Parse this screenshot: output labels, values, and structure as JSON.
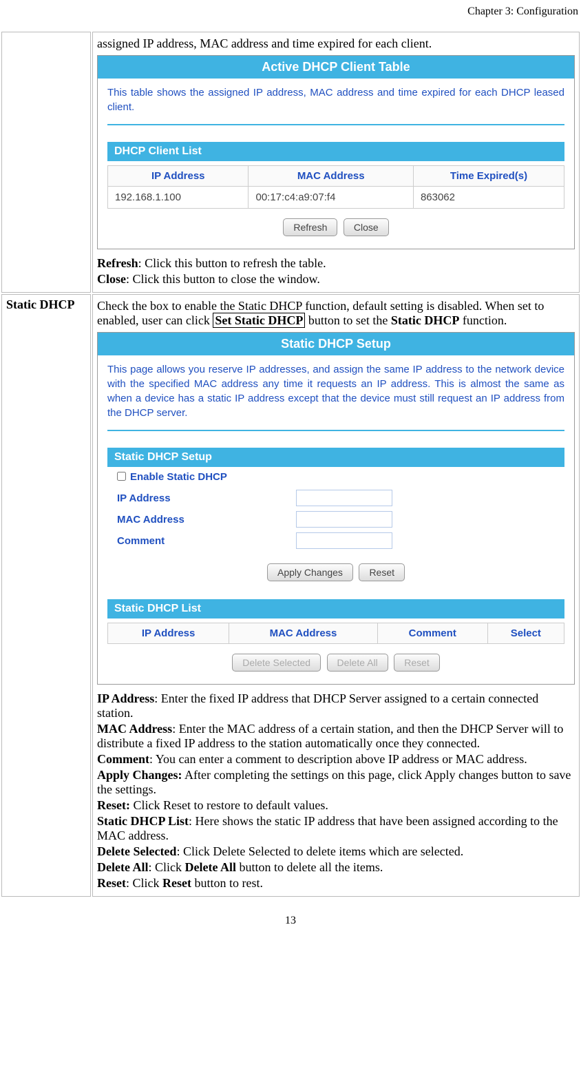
{
  "header": {
    "chapter": "Chapter 3: Configuration"
  },
  "row1": {
    "intro": "assigned IP address, MAC address and time expired for each client.",
    "panel_title": "Active DHCP Client Table",
    "panel_desc": "This table shows the assigned IP address, MAC address and time expired for each DHCP leased client.",
    "subtitle": "DHCP Client List",
    "cols": {
      "ip": "IP Address",
      "mac": "MAC Address",
      "time": "Time Expired(s)"
    },
    "data_row": {
      "ip": "192.168.1.100",
      "mac": "00:17:c4:a9:07:f4",
      "time": "863062"
    },
    "btn_refresh": "Refresh",
    "btn_close": "Close",
    "def_refresh_label": "Refresh",
    "def_refresh_text": ": Click this button to refresh the table.",
    "def_close_label": "Close",
    "def_close_text": ": Click this button to close the window."
  },
  "row2": {
    "label": "Static DHCP",
    "intro1": "Check the box to enable the Static DHCP function, default setting is disabled. When set to enabled, user can click ",
    "intro_boxed": "Set Static DHCP",
    "intro2": " button to set the ",
    "intro_bold": "Static DHCP",
    "intro3": " function.",
    "panel_title": "Static DHCP Setup",
    "panel_desc": "This page allows you reserve IP addresses, and assign the same IP address to the network device with the specified MAC address any time it requests an IP address. This is almost the same as when a device has a static IP address except that the device must still request an IP address from the DHCP server.",
    "subtitle_setup": "Static DHCP Setup",
    "enable_label": "Enable Static DHCP",
    "form": {
      "ip": "IP Address",
      "mac": "MAC Address",
      "comment": "Comment"
    },
    "btn_apply": "Apply Changes",
    "btn_reset": "Reset",
    "subtitle_list": "Static DHCP List",
    "list_cols": {
      "ip": "IP Address",
      "mac": "MAC Address",
      "comment": "Comment",
      "select": "Select"
    },
    "btn_delsel": "Delete Selected",
    "btn_delall": "Delete All",
    "btn_reset2": "Reset",
    "defs": {
      "ip_label": "IP Address",
      "ip_text": ": Enter the fixed IP address that DHCP Server assigned to a certain connected station.",
      "mac_label": "MAC Address",
      "mac_text": ": Enter the MAC address of a certain station, and then the DHCP Server will to distribute a fixed IP address to the station automatically once they connected.",
      "comment_label": "Comment",
      "comment_text": ": You can enter a comment to description above IP address or MAC address.",
      "apply_label": "Apply Changes:",
      "apply_text": " After completing the settings on this page, click Apply changes button to save the settings.",
      "reset_label": "Reset:",
      "reset_text": " Click Reset to restore to default values.",
      "list_label": "Static DHCP List",
      "list_text": ": Here shows the static IP address that have been assigned according to the MAC address.",
      "delsel_label": "Delete Selected",
      "delsel_text": ": Click Delete Selected to delete items which are selected.",
      "delall_label": "Delete All",
      "delall_text1": ": Click ",
      "delall_bold": "Delete All",
      "delall_text2": " button to delete all the items.",
      "reset2_label": "Reset",
      "reset2_text1": ": Click ",
      "reset2_bold": "Reset",
      "reset2_text2": " button to rest."
    }
  },
  "footer": {
    "page": "13"
  }
}
